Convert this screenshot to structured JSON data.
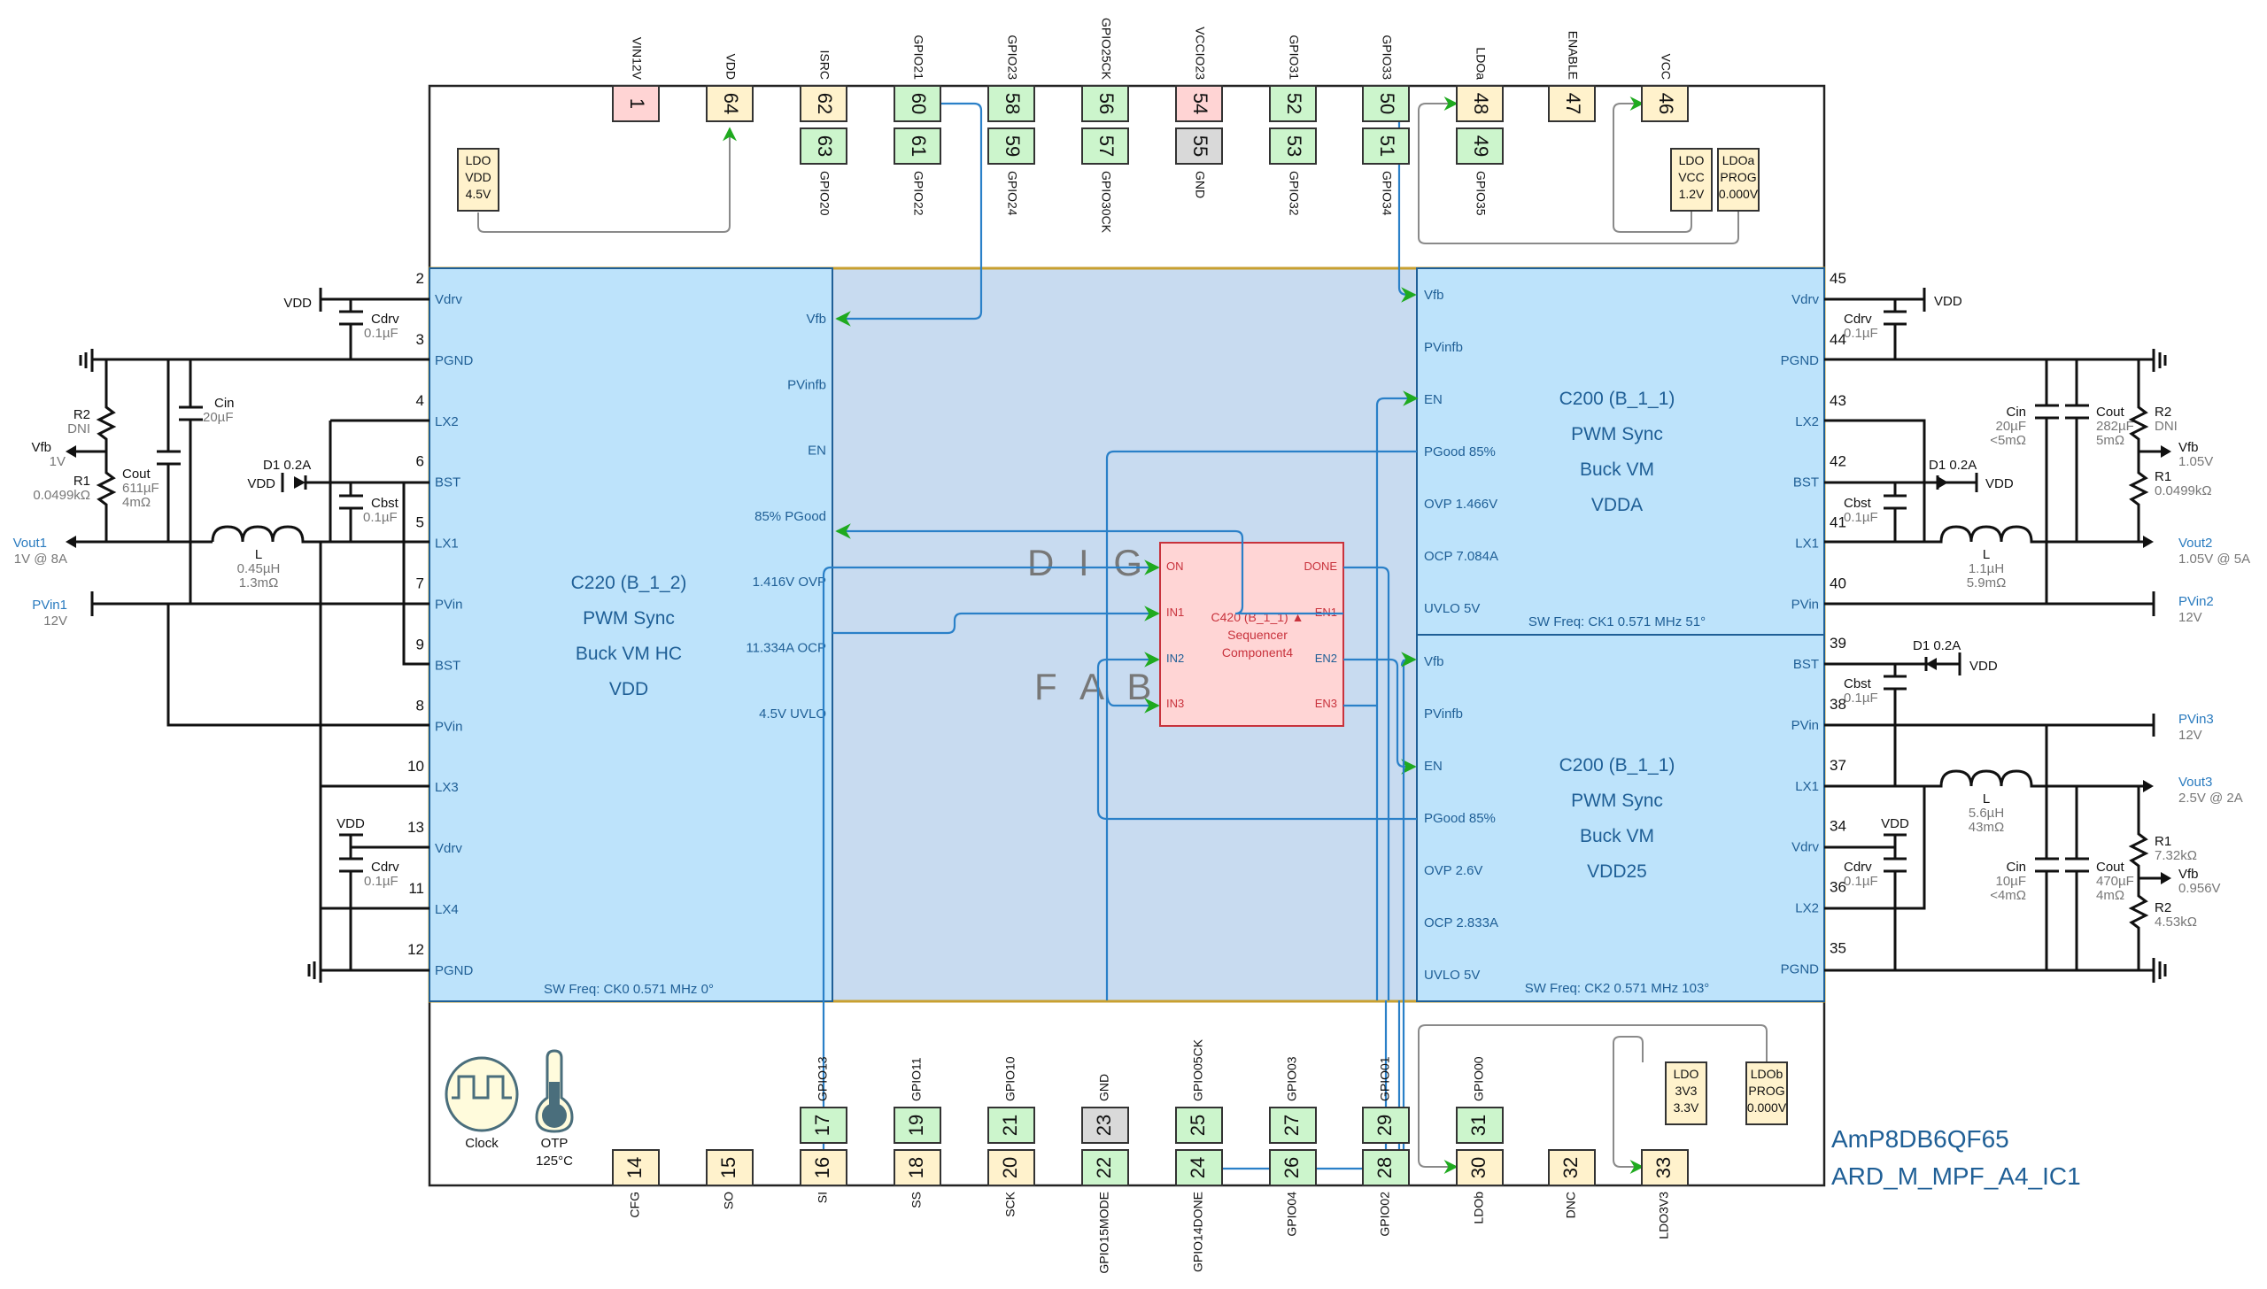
{
  "device": {
    "part_number": "AmP8DB6QF65",
    "design_name": "ARD_M_MPF_A4_IC1",
    "fabric_label": "DIGITAL FABRIC",
    "fabric_visible_1": "D I G I T",
    "fabric_visible_2": "F A B R"
  },
  "colors": {
    "pin_power": "#fff2cc",
    "pin_gpio": "#ccf5cc",
    "pin_vin": "#ffd4d4",
    "pin_gnd": "#d9d9d9",
    "buck_fill": "#bde3fb",
    "fabric_fill": "#c8dbf0",
    "sequencer_fill": "#ffd5d5",
    "signal_wire": "#2a80c8",
    "arrow": "#1faa1f",
    "text_blue": "#1f5f96",
    "fabric_border": "#c8a030"
  },
  "top_pins": [
    {
      "num": "1",
      "name": "VIN12V",
      "type": "vin",
      "row": "outer"
    },
    {
      "num": "64",
      "name": "VDD",
      "type": "power",
      "row": "outer"
    },
    {
      "num": "62",
      "name": "ISRC",
      "type": "power",
      "row": "outer"
    },
    {
      "num": "63",
      "name": "GPIO20",
      "type": "gpio",
      "row": "inner"
    },
    {
      "num": "60",
      "name": "GPIO21",
      "type": "gpio",
      "row": "outer"
    },
    {
      "num": "61",
      "name": "GPIO22",
      "type": "gpio",
      "row": "inner"
    },
    {
      "num": "58",
      "name": "GPIO23",
      "type": "gpio",
      "row": "outer"
    },
    {
      "num": "59",
      "name": "GPIO24",
      "type": "gpio",
      "row": "inner"
    },
    {
      "num": "56",
      "name": "GPIO25CK",
      "type": "gpio",
      "row": "outer"
    },
    {
      "num": "57",
      "name": "GPIO30CK",
      "type": "gpio",
      "row": "inner"
    },
    {
      "num": "54",
      "name": "VCCIO23",
      "type": "vin",
      "row": "outer"
    },
    {
      "num": "55",
      "name": "GND",
      "type": "gnd",
      "row": "inner"
    },
    {
      "num": "52",
      "name": "GPIO31",
      "type": "gpio",
      "row": "outer"
    },
    {
      "num": "53",
      "name": "GPIO32",
      "type": "gpio",
      "row": "inner"
    },
    {
      "num": "50",
      "name": "GPIO33",
      "type": "gpio",
      "row": "outer"
    },
    {
      "num": "51",
      "name": "GPIO34",
      "type": "gpio",
      "row": "inner"
    },
    {
      "num": "48",
      "name": "LDOa",
      "type": "power",
      "row": "outer"
    },
    {
      "num": "49",
      "name": "GPIO35",
      "type": "gpio",
      "row": "inner"
    },
    {
      "num": "47",
      "name": "ENABLE",
      "type": "power",
      "row": "outer"
    },
    {
      "num": "46",
      "name": "VCC",
      "type": "power",
      "row": "outer"
    }
  ],
  "bottom_pins": [
    {
      "num": "14",
      "name": "CFG",
      "type": "power",
      "row": "outer"
    },
    {
      "num": "15",
      "name": "SO",
      "type": "power",
      "row": "outer"
    },
    {
      "num": "16",
      "name": "SI",
      "type": "power",
      "row": "outer"
    },
    {
      "num": "17",
      "name": "GPIO13",
      "type": "gpio",
      "row": "inner"
    },
    {
      "num": "18",
      "name": "SS",
      "type": "power",
      "row": "outer"
    },
    {
      "num": "19",
      "name": "GPIO11",
      "type": "gpio",
      "row": "inner"
    },
    {
      "num": "20",
      "name": "SCK",
      "type": "power",
      "row": "outer"
    },
    {
      "num": "21",
      "name": "GPIO10",
      "type": "gpio",
      "row": "inner"
    },
    {
      "num": "22",
      "name": "GPIO15MODE",
      "type": "gpio",
      "row": "outer"
    },
    {
      "num": "23",
      "name": "GND",
      "type": "gnd",
      "row": "inner"
    },
    {
      "num": "24",
      "name": "GPIO14DONE",
      "type": "gpio",
      "row": "outer"
    },
    {
      "num": "25",
      "name": "GPIO05CK",
      "type": "gpio",
      "row": "inner"
    },
    {
      "num": "26",
      "name": "GPIO04",
      "type": "gpio",
      "row": "outer"
    },
    {
      "num": "27",
      "name": "GPIO03",
      "type": "gpio",
      "row": "inner"
    },
    {
      "num": "28",
      "name": "GPIO02",
      "type": "gpio",
      "row": "outer"
    },
    {
      "num": "29",
      "name": "GPIO01",
      "type": "gpio",
      "row": "inner"
    },
    {
      "num": "30",
      "name": "LDOb",
      "type": "power",
      "row": "outer"
    },
    {
      "num": "31",
      "name": "GPIO00",
      "type": "gpio",
      "row": "inner"
    },
    {
      "num": "32",
      "name": "DNC",
      "type": "power",
      "row": "outer"
    },
    {
      "num": "33",
      "name": "LDO3V3",
      "type": "power",
      "row": "outer"
    }
  ],
  "ldo_boxes": {
    "ldo_vdd": [
      "LDO",
      "VDD",
      "4.5V"
    ],
    "ldo_vcc": [
      "LDO",
      "VCC",
      "1.2V"
    ],
    "ldoa_prog": [
      "LDOa",
      "PROG",
      "0.000V"
    ],
    "ldo_3v3": [
      "LDO",
      "3V3",
      "3.3V"
    ],
    "ldob_prog": [
      "LDOb",
      "PROG",
      "0.000V"
    ]
  },
  "indicators": {
    "clock_label": "Clock",
    "otp_label": "OTP",
    "otp_value": "125°C"
  },
  "buck_left": {
    "title": [
      "C220 (B_1_2)",
      "PWM Sync",
      "Buck VM HC",
      "VDD"
    ],
    "sw_freq": "SW Freq: CK0 0.571 MHz 0°",
    "left_pins": [
      {
        "num": "2",
        "name": "Vdrv"
      },
      {
        "num": "3",
        "name": "PGND"
      },
      {
        "num": "4",
        "name": "LX2"
      },
      {
        "num": "6",
        "name": "BST"
      },
      {
        "num": "5",
        "name": "LX1"
      },
      {
        "num": "7",
        "name": "PVin"
      },
      {
        "num": "9",
        "name": "BST"
      },
      {
        "num": "8",
        "name": "PVin"
      },
      {
        "num": "10",
        "name": "LX3"
      },
      {
        "num": "13",
        "name": "Vdrv"
      },
      {
        "num": "11",
        "name": "LX4"
      },
      {
        "num": "12",
        "name": "PGND"
      }
    ],
    "right_labels": [
      "Vfb",
      "PVinfb",
      "EN",
      "85% PGood",
      "1.416V OVP",
      "11.334A OCP",
      "4.5V UVLO"
    ]
  },
  "buck_right_top": {
    "title": [
      "C200 (B_1_1)",
      "PWM Sync",
      "Buck VM",
      "VDDA"
    ],
    "sw_freq": "SW Freq: CK1 0.571 MHz 51°",
    "left_labels": [
      "Vfb",
      "PVinfb",
      "EN",
      "PGood 85%",
      "OVP 1.466V",
      "OCP 7.084A",
      "UVLO 5V"
    ],
    "right_pins": [
      {
        "num": "45",
        "name": "Vdrv"
      },
      {
        "num": "44",
        "name": "PGND"
      },
      {
        "num": "43",
        "name": "LX2"
      },
      {
        "num": "42",
        "name": "BST"
      },
      {
        "num": "41",
        "name": "LX1"
      },
      {
        "num": "40",
        "name": "PVin"
      }
    ]
  },
  "buck_right_bottom": {
    "title": [
      "C200 (B_1_1)",
      "PWM Sync",
      "Buck VM",
      "VDD25"
    ],
    "sw_freq": "SW Freq: CK2 0.571 MHz 103°",
    "left_labels": [
      "Vfb",
      "PVinfb",
      "EN",
      "PGood 85%",
      "OVP 2.6V",
      "OCP 2.833A",
      "UVLO 5V"
    ],
    "right_pins": [
      {
        "num": "39",
        "name": "BST"
      },
      {
        "num": "38",
        "name": "PVin"
      },
      {
        "num": "37",
        "name": "LX1"
      },
      {
        "num": "34",
        "name": "Vdrv"
      },
      {
        "num": "36",
        "name": "LX2"
      },
      {
        "num": "35",
        "name": "PGND"
      }
    ]
  },
  "sequencer": {
    "title": [
      "C420 (B_1_1) ▲",
      "Sequencer",
      "Component4"
    ],
    "inputs": [
      "ON",
      "IN1",
      "IN2",
      "IN3"
    ],
    "outputs": [
      "DONE",
      "EN1",
      "EN2",
      "EN3"
    ]
  },
  "rail1": {
    "vdd": "VDD",
    "cdrv": {
      "name": "Cdrv",
      "value": "0.1µF"
    },
    "cin": {
      "name": "Cin",
      "value": "20µF"
    },
    "r2": {
      "name": "R2",
      "value": "DNI"
    },
    "vfb": {
      "name": "Vfb",
      "value": "1V"
    },
    "r1": {
      "name": "R1",
      "value": "0.0499kΩ"
    },
    "cout": {
      "name": "Cout",
      "value": "611µF",
      "esr": "4mΩ"
    },
    "d1": "D1 0.2A",
    "cbst": {
      "name": "Cbst",
      "value": "0.1µF"
    },
    "vout": {
      "name": "Vout1",
      "value": "1V @ 8A"
    },
    "inductor": {
      "name": "L",
      "value": "0.45µH",
      "dcr": "1.3mΩ"
    },
    "pvin": {
      "name": "PVin1",
      "value": "12V"
    },
    "cdrv2": {
      "name": "Cdrv",
      "value": "0.1µF"
    }
  },
  "rail2": {
    "vdd": "VDD",
    "cdrv": {
      "name": "Cdrv",
      "value": "0.1µF"
    },
    "cin": {
      "name": "Cin",
      "value": "20µF",
      "esr": "<5mΩ"
    },
    "cout": {
      "name": "Cout",
      "value": "282µF",
      "esr": "5mΩ"
    },
    "r2": {
      "name": "R2",
      "value": "DNI"
    },
    "vfb": {
      "name": "Vfb",
      "value": "1.05V"
    },
    "r1": {
      "name": "R1",
      "value": "0.0499kΩ"
    },
    "d1": "D1 0.2A",
    "cbst": {
      "name": "Cbst",
      "value": "0.1µF"
    },
    "inductor": {
      "name": "L",
      "value": "1.1µH",
      "dcr": "5.9mΩ"
    },
    "vout": {
      "name": "Vout2",
      "value": "1.05V @ 5A"
    },
    "pvin": {
      "name": "PVin2",
      "value": "12V"
    }
  },
  "rail3": {
    "vdd": "VDD",
    "d1": "D1 0.2A",
    "cbst": {
      "name": "Cbst",
      "value": "0.1µF"
    },
    "pvin": {
      "name": "PVin3",
      "value": "12V"
    },
    "inductor": {
      "name": "L",
      "value": "5.6µH",
      "dcr": "43mΩ"
    },
    "vout": {
      "name": "Vout3",
      "value": "2.5V @ 2A"
    },
    "cdrv": {
      "name": "Cdrv",
      "value": "0.1µF"
    },
    "r1": {
      "name": "R1",
      "value": "7.32kΩ"
    },
    "cin": {
      "name": "Cin",
      "value": "10µF",
      "esr": "<4mΩ"
    },
    "cout": {
      "name": "Cout",
      "value": "470µF",
      "esr": "4mΩ"
    },
    "vfb": {
      "name": "Vfb",
      "value": "0.956V"
    },
    "r2": {
      "name": "R2",
      "value": "4.53kΩ"
    }
  }
}
